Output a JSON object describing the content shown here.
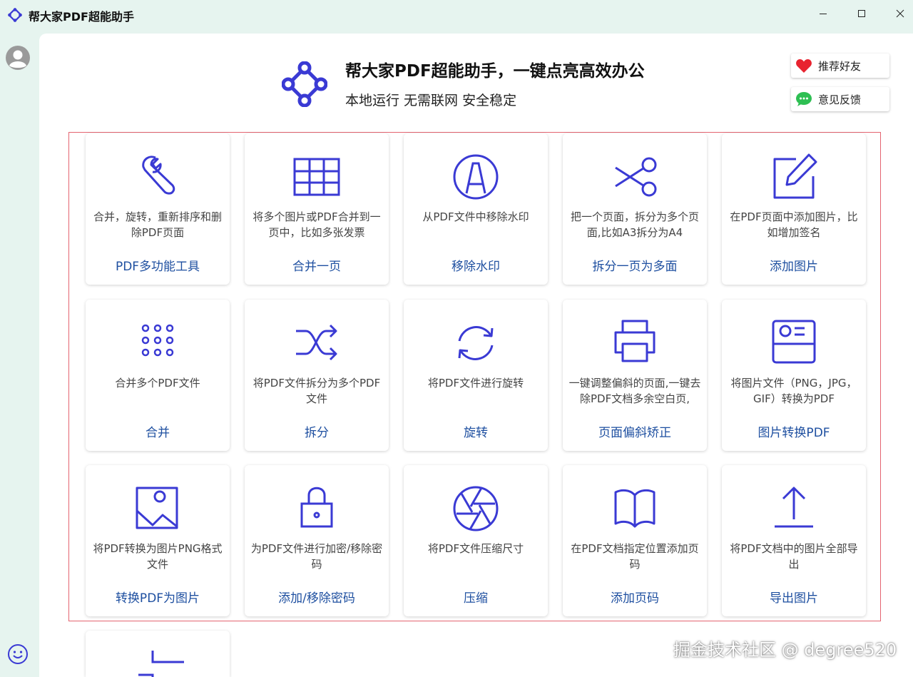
{
  "window": {
    "title": "帮大家PDF超能助手",
    "minimize_icon": "minimize-icon",
    "maximize_icon": "maximize-icon",
    "close_icon": "close-icon"
  },
  "header": {
    "title": "帮大家PDF超能助手，一键点亮高效办公",
    "subtitle": "本地运行 无需联网 安全稳定",
    "buttons": [
      {
        "label": "推荐好友",
        "icon": "heart-icon"
      },
      {
        "label": "意见反馈",
        "icon": "chat-icon"
      }
    ]
  },
  "colors": {
    "accent": "#3a3ad4",
    "label": "#1e4fa0",
    "frame": "#e46470",
    "sidebar_bg": "#e6f4ef"
  },
  "tools": [
    {
      "icon": "wrench-icon",
      "desc": "合并，旋转，重新排序和删除PDF页面",
      "label": "PDF多功能工具"
    },
    {
      "icon": "grid-table-icon",
      "desc": "将多个图片或PDF合并到一页中，比如多张发票",
      "label": "合并一页"
    },
    {
      "icon": "watermark-a-icon",
      "desc": "从PDF文件中移除水印",
      "label": "移除水印"
    },
    {
      "icon": "scissors-icon",
      "desc": "把一个页面，拆分为多个页面,比如A3拆分为A4",
      "label": "拆分一页为多面"
    },
    {
      "icon": "edit-icon",
      "desc": "在PDF页面中添加图片，比如增加签名",
      "label": "添加图片"
    },
    {
      "icon": "dots-grid-icon",
      "desc": "合并多个PDF文件",
      "label": "合并"
    },
    {
      "icon": "shuffle-icon",
      "desc": "将PDF文件拆分为多个PDF文件",
      "label": "拆分"
    },
    {
      "icon": "rotate-icon",
      "desc": "将PDF文件进行旋转",
      "label": "旋转"
    },
    {
      "icon": "printer-icon",
      "desc": "一键调整偏斜的页面,一键去除PDF文档多余空白页,",
      "label": "页面偏斜矫正"
    },
    {
      "icon": "id-card-icon",
      "desc": "将图片文件（PNG，JPG，GIF）转换为PDF",
      "label": "图片转换PDF"
    },
    {
      "icon": "image-icon",
      "desc": "将PDF转换为图片PNG格式文件",
      "label": "转换PDF为图片"
    },
    {
      "icon": "lock-icon",
      "desc": "为PDF文件进行加密/移除密码",
      "label": "添加/移除密码"
    },
    {
      "icon": "aperture-icon",
      "desc": "将PDF文件压缩尺寸",
      "label": "压缩"
    },
    {
      "icon": "book-icon",
      "desc": "在PDF文档指定位置添加页码",
      "label": "添加页码"
    },
    {
      "icon": "upload-icon",
      "desc": "将PDF文档中的图片全部导出",
      "label": "导出图片"
    },
    {
      "icon": "crop-icon",
      "desc": "",
      "label": ""
    }
  ],
  "watermark": "掘金技术社区 @ degree520"
}
